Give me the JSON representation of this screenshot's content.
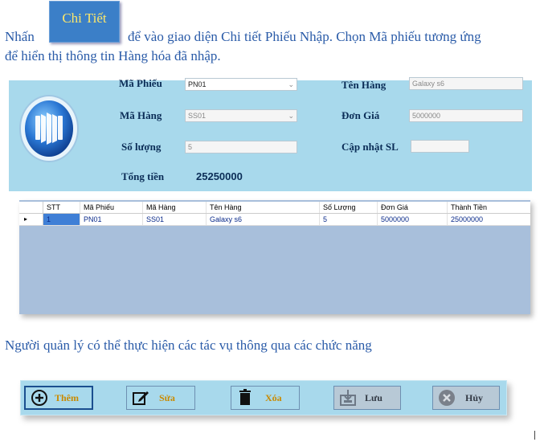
{
  "intro": {
    "part1": "Nhấn",
    "chip_label": "Chi Tiết",
    "part2": "để vào giao diện Chi tiết Phiếu Nhập. Chọn Mã phiếu tương ứng",
    "line2": "để hiển thị thông tin Hàng hóa đã nhập."
  },
  "form": {
    "ma_phieu_label": "Mã Phiếu",
    "ma_phieu_value": "PN01",
    "ma_hang_label": "Mã Hàng",
    "ma_hang_value": "SS01",
    "so_luong_label": "Số lượng",
    "so_luong_value": "5",
    "tong_tien_label": "Tổng tiền",
    "tong_tien_value": "25250000",
    "ten_hang_label": "Tên Hàng",
    "ten_hang_value": "Galaxy s6",
    "don_gia_label": "Đơn Giá",
    "don_gia_value": "5000000",
    "cap_nhat_label": "Cập nhật SL",
    "cap_nhat_value": "",
    "logo_icon": "accordion-icon"
  },
  "grid": {
    "columns": [
      "STT",
      "Mã Phiếu",
      "Mã Hàng",
      "Tên Hàng",
      "Số Lượng",
      "Đơn Giá",
      "Thành Tiền"
    ],
    "rows": [
      [
        "1",
        "PN01",
        "SS01",
        "Galaxy s6",
        "5",
        "5000000",
        "25000000"
      ]
    ],
    "selected_indicator": "▸"
  },
  "outro": {
    "text": "Người quản lý có thể thực hiện các tác vụ thông qua các chức năng"
  },
  "toolbar": {
    "them": "Thêm",
    "sua": "Sửa",
    "xoa": "Xóa",
    "luu": "Lưu",
    "huy": "Hủy"
  },
  "colors": {
    "panel": "#a8d9ec",
    "text_blue": "#2a5ba8",
    "chip": "#3b7fc8",
    "grid_bg": "#a8bfdb",
    "accent_yellow": "#c98a00"
  }
}
